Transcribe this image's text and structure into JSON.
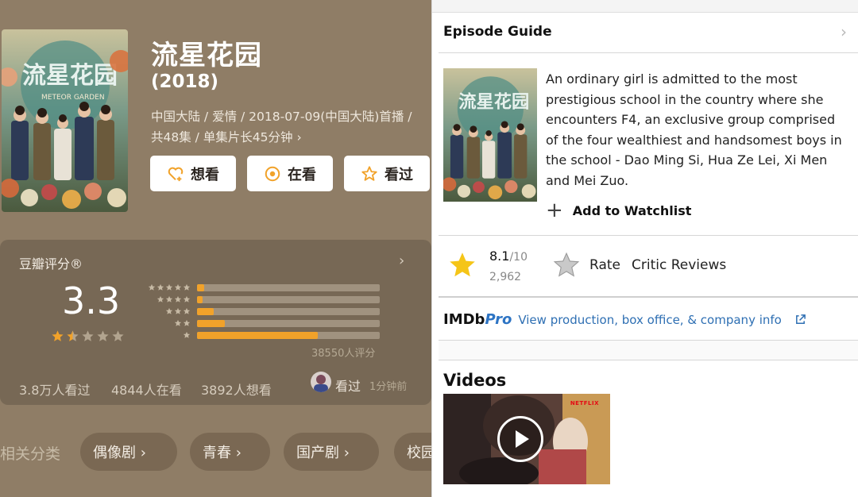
{
  "douban": {
    "title": "流星花园",
    "year": "(2018)",
    "meta": "中国大陆 / 爱情 / 2018-07-09(中国大陆)首播 / 共48集 / 单集片长45分钟 ›",
    "buttons": [
      {
        "label": "想看",
        "icon": "heart-plus-icon"
      },
      {
        "label": "在看",
        "icon": "target-icon"
      },
      {
        "label": "看过",
        "icon": "star-outline-icon"
      }
    ],
    "rating": {
      "label": "豆瓣评分®",
      "score": "3.3",
      "stars_filled": 1.5,
      "distribution": [
        {
          "stars": 5,
          "fraction": 0.04
        },
        {
          "stars": 4,
          "fraction": 0.03
        },
        {
          "stars": 3,
          "fraction": 0.09
        },
        {
          "stars": 2,
          "fraction": 0.15
        },
        {
          "stars": 1,
          "fraction": 0.66
        }
      ],
      "count": "38550人评分",
      "stats": [
        "3.8万人看过",
        "4844人在看",
        "3892人想看"
      ],
      "recent_action": "看过",
      "recent_time": "1分钟前"
    },
    "tags_label": "相关分类",
    "tags": [
      "偶像剧 ›",
      "青春 ›",
      "国产剧 ›",
      "校园"
    ]
  },
  "imdb": {
    "section_title": "Episode Guide",
    "plot": "An ordinary girl is admitted to the most prestigious school in the country where she encounters F4, an exclusive group comprised of the four wealthiest and handsomest boys in the school - Dao Ming Si, Hua Ze Lei, Xi Men and Mei Zuo.",
    "watchlist_label": "Add to Watchlist",
    "rating_value": "8.1",
    "rating_max": "/10",
    "vote_count": "2,962",
    "rate_label": "Rate",
    "critic_label": "Critic Reviews",
    "pro_logo_a": "IMDb",
    "pro_logo_b": "Pro",
    "pro_link": "View production, box office, & company info",
    "videos_title": "Videos",
    "video_badge": "NETFLIX"
  },
  "colors": {
    "douban_bg": "#8f7d66",
    "douban_accent": "#f1a22a",
    "imdb_star": "#f5c518",
    "imdb_link": "#2e6fb3"
  }
}
